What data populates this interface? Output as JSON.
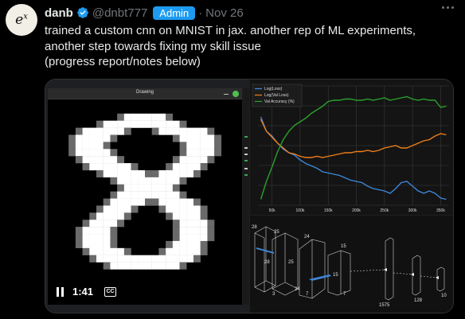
{
  "post": {
    "author_name": "danb",
    "handle": "@dnbt777",
    "badge": "Admin",
    "separator": "·",
    "date": "Nov 26",
    "avatar_text": "e",
    "avatar_sup": "x",
    "text_lines": [
      "trained a custom cnn on MNIST in jax. another rep of ML experiments,",
      "another step towards fixing my skill issue",
      "(progress report/notes below)"
    ]
  },
  "video": {
    "window_title": "Drawing",
    "time": "1:41",
    "cc_label": "CC"
  },
  "chart_data": {
    "type": "line",
    "legend": [
      "Log(Loss)",
      "Log(Val Loss)",
      "Val Accuracy (%)"
    ],
    "legend_position": "top-left",
    "series_colors": [
      "#3d87d8",
      "#ef7d1a",
      "#2ca02c"
    ],
    "x_ticks": [
      "50k",
      "100k",
      "150k",
      "200k",
      "250k",
      "300k",
      "350k"
    ],
    "x": [
      30000,
      40000,
      50000,
      60000,
      70000,
      80000,
      90000,
      100000,
      110000,
      120000,
      130000,
      140000,
      150000,
      160000,
      170000,
      180000,
      190000,
      200000,
      210000,
      220000,
      230000,
      240000,
      250000,
      260000,
      270000,
      280000,
      290000,
      300000,
      310000,
      320000,
      330000,
      340000,
      350000,
      360000
    ],
    "series": [
      {
        "name": "Log(Loss)",
        "values": [
          0.74,
          0.62,
          0.58,
          0.52,
          0.47,
          0.44,
          0.42,
          0.38,
          0.35,
          0.33,
          0.31,
          0.28,
          0.27,
          0.26,
          0.25,
          0.23,
          0.21,
          0.2,
          0.19,
          0.16,
          0.14,
          0.13,
          0.12,
          0.1,
          0.14,
          0.19,
          0.2,
          0.16,
          0.12,
          0.1,
          0.12,
          0.1,
          0.06,
          0.05
        ]
      },
      {
        "name": "Log(Val Loss)",
        "values": [
          0.72,
          0.62,
          0.57,
          0.52,
          0.48,
          0.44,
          0.43,
          0.41,
          0.4,
          0.4,
          0.41,
          0.4,
          0.41,
          0.42,
          0.43,
          0.44,
          0.44,
          0.45,
          0.45,
          0.46,
          0.45,
          0.46,
          0.48,
          0.49,
          0.5,
          0.48,
          0.48,
          0.5,
          0.52,
          0.54,
          0.55,
          0.58,
          0.6,
          0.59
        ]
      },
      {
        "name": "Val Accuracy (%)",
        "values": [
          0.05,
          0.2,
          0.32,
          0.45,
          0.55,
          0.62,
          0.67,
          0.7,
          0.73,
          0.77,
          0.8,
          0.83,
          0.87,
          0.88,
          0.88,
          0.89,
          0.89,
          0.88,
          0.88,
          0.89,
          0.88,
          0.89,
          0.9,
          0.88,
          0.89,
          0.9,
          0.91,
          0.89,
          0.88,
          0.89,
          0.88,
          0.88,
          0.82,
          0.83
        ]
      }
    ],
    "grid": true
  },
  "diagram": {
    "labels": [
      "28",
      "25",
      "24",
      "15",
      "28",
      "25",
      "24",
      "15",
      "3",
      "7",
      "7",
      "1575",
      "128",
      "10"
    ]
  },
  "colors": {
    "accent": "#1d9bf0",
    "muted": "#71767b",
    "text": "#e7e9ea"
  }
}
